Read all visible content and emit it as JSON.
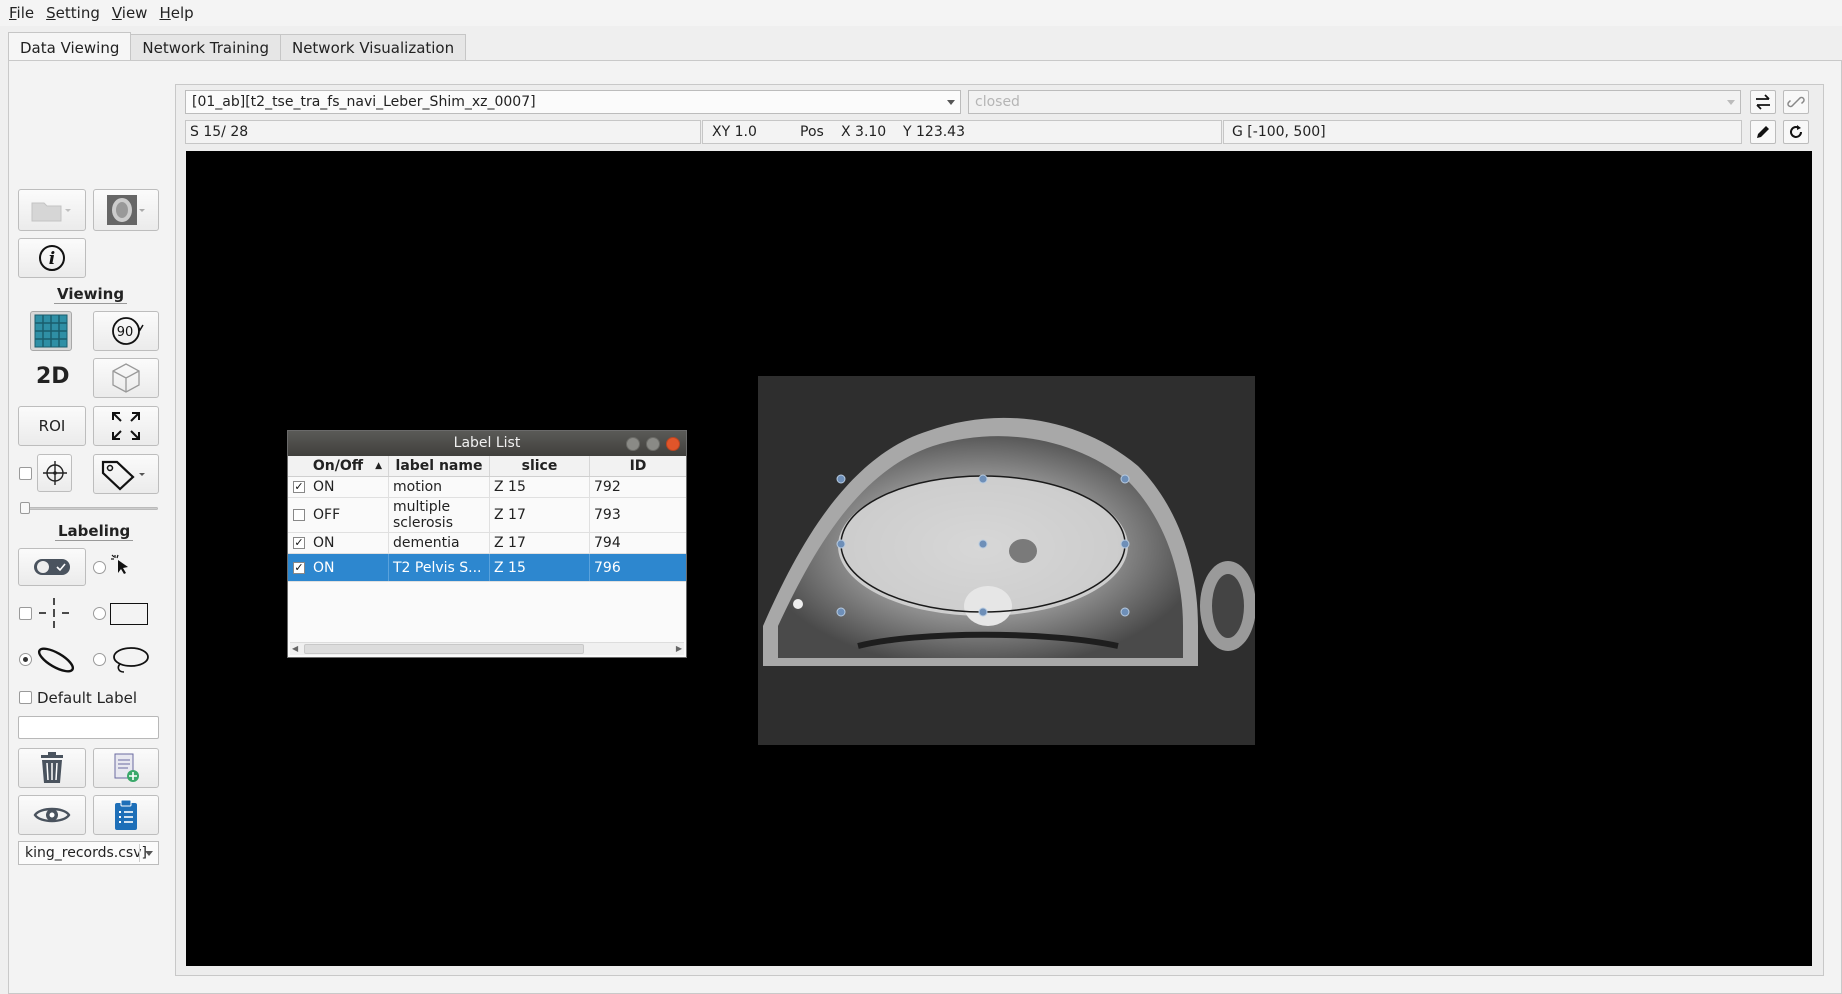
{
  "menu": [
    "File",
    "Setting",
    "View",
    "Help"
  ],
  "tabs": [
    "Data Viewing",
    "Network Training",
    "Network Visualization"
  ],
  "sidebar": {
    "viewing_label": "Viewing",
    "labeling_label": "Labeling",
    "rotate_label": "90",
    "mode_2d": "2D",
    "roi_label": "ROI",
    "default_label": "Default Label",
    "default_label_value": "",
    "records_file": "king_records.csv]"
  },
  "viewer": {
    "sequence": "[01_ab][t2_tse_tra_fs_navi_Leber_Shim_xz_0007]",
    "state": "closed",
    "slice_info": "S 15/ 28",
    "zoom": "XY 1.0",
    "pos_label": "Pos",
    "pos_x": "X 3.10",
    "pos_y": "Y 123.43",
    "gray_range": "G [-100, 500]"
  },
  "label_list": {
    "title": "Label List",
    "columns": [
      "On/Off",
      "label name",
      "slice",
      "ID"
    ],
    "rows": [
      {
        "checked": true,
        "state": "ON",
        "name": "motion",
        "slice": "Z 15",
        "id": "792"
      },
      {
        "checked": false,
        "state": "OFF",
        "name": "multiple sclerosis",
        "slice": "Z 17",
        "id": "793"
      },
      {
        "checked": true,
        "state": "ON",
        "name": "dementia",
        "slice": "Z 17",
        "id": "794"
      },
      {
        "checked": true,
        "state": "ON",
        "name": "T2 Pelvis S...",
        "slice": "Z 15",
        "id": "796",
        "selected": true
      }
    ]
  },
  "colors": {
    "selection": "#2d87cf",
    "canvas": "#000000",
    "close_button": "#e0552a"
  }
}
